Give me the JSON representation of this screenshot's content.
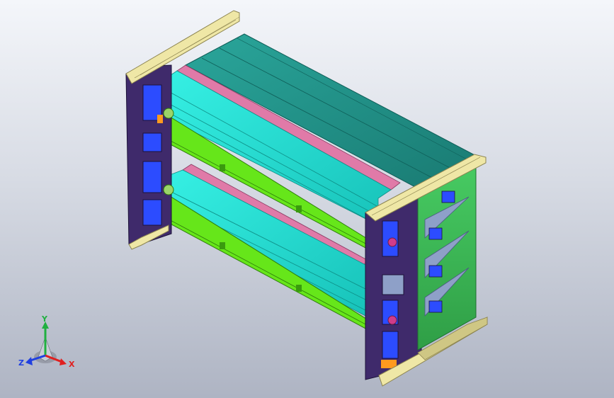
{
  "viewport": {
    "background_top": "#f4f6fa",
    "background_bottom": "#aeb4c3"
  },
  "model": {
    "colors": {
      "frame_purple": "#3f2a6b",
      "frame_purple_dark": "#2a1b4d",
      "plate_green": "#3fbf5a",
      "plate_green_dark": "#2a8f40",
      "rail_green": "#66e61a",
      "rail_green_dark": "#3a9a0f",
      "panel_cyan": "#1fe0d6",
      "panel_cyan_dark": "#16a8a2",
      "top_teal": "#1d8f86",
      "top_teal_light": "#2fb0a4",
      "strip_pink": "#e07aa8",
      "yellow": "#efe7a6",
      "yellow_dark": "#cfc784",
      "blue": "#2c4cff",
      "grey_blue": "#8ea0c8",
      "magenta": "#d03c8a",
      "orange": "#ff9a1f"
    }
  },
  "triad": {
    "x_label": "X",
    "y_label": "Y",
    "z_label": "Z",
    "x_color": "#e02020",
    "y_color": "#20b040",
    "z_color": "#2040e0"
  }
}
